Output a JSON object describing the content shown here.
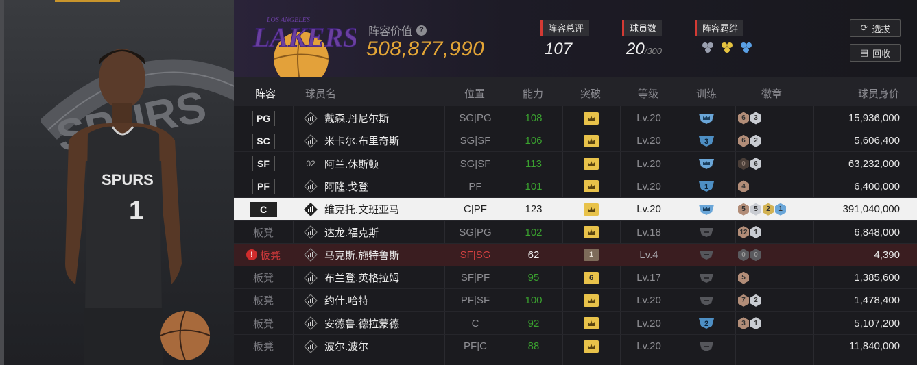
{
  "header": {
    "value_label": "阵容价值",
    "value": "508,877,990",
    "stats": [
      {
        "label": "阵容总评",
        "value": "107",
        "sub": ""
      },
      {
        "label": "球员数",
        "value": "20",
        "sub": "/300"
      },
      {
        "label": "阵容羁绊",
        "value": "",
        "sub": ""
      }
    ],
    "buttons": {
      "draft": "选拔",
      "recycle": "回收"
    },
    "team": "LOS ANGELES LAKERS",
    "accent": "#e3a536"
  },
  "table": {
    "columns": [
      "阵容",
      "球员名",
      "位置",
      "能力",
      "突破",
      "等级",
      "训练",
      "徽章",
      "球员身价"
    ],
    "rows": [
      {
        "slot": "PG",
        "signal": "bars",
        "name": "戴森.丹尼尔斯",
        "position": "SG|PG",
        "ability": "108",
        "break": "crown",
        "level": "Lv.20",
        "train": "shield-blue",
        "train_num": "",
        "medals": [
          {
            "t": "m-bronze",
            "n": "6"
          },
          {
            "t": "m-silver",
            "n": "3"
          }
        ],
        "price": "15,936,000"
      },
      {
        "slot": "SC",
        "signal": "bars",
        "name": "米卡尔.布里奇斯",
        "position": "SG|SF",
        "ability": "106",
        "break": "crown",
        "level": "Lv.20",
        "train": "num-blue",
        "train_num": "3",
        "medals": [
          {
            "t": "m-bronze",
            "n": "6"
          },
          {
            "t": "m-silver",
            "n": "2"
          }
        ],
        "price": "5,606,400"
      },
      {
        "slot": "SF",
        "signal": "text",
        "signal_text": "02",
        "name": "阿兰.休斯顿",
        "position": "SG|SF",
        "ability": "113",
        "break": "crown",
        "level": "Lv.20",
        "train": "shield-blue",
        "train_num": "",
        "medals": [
          {
            "t": "m-dark",
            "n": "0"
          },
          {
            "t": "m-silver",
            "n": "6"
          }
        ],
        "price": "63,232,000"
      },
      {
        "slot": "PF",
        "signal": "bars",
        "name": "阿隆.戈登",
        "position": "PF",
        "ability": "101",
        "break": "crown",
        "level": "Lv.20",
        "train": "num-blue",
        "train_num": "1",
        "medals": [
          {
            "t": "m-bronze",
            "n": "4"
          }
        ],
        "price": "6,400,000"
      },
      {
        "slot": "C",
        "signal": "diamond",
        "name": "维克托.文班亚马",
        "position": "C|PF",
        "ability": "123",
        "break": "crown",
        "level": "Lv.20",
        "train": "shield-blue",
        "train_num": "",
        "medals": [
          {
            "t": "m-bronze",
            "n": "5"
          },
          {
            "t": "m-silver",
            "n": "5"
          },
          {
            "t": "m-gold",
            "n": "2"
          },
          {
            "t": "m-blue",
            "n": "1"
          }
        ],
        "price": "391,040,000",
        "highlight": true
      },
      {
        "slot": "板凳",
        "signal": "bars",
        "name": "达龙.福克斯",
        "position": "SG|PG",
        "ability": "102",
        "break": "crown",
        "level": "Lv.18",
        "train": "gray",
        "train_num": "",
        "medals": [
          {
            "t": "m-bronze",
            "n": "12"
          },
          {
            "t": "m-silver",
            "n": "1"
          }
        ],
        "price": "6,848,000"
      },
      {
        "slot": "板凳",
        "signal": "bars",
        "name": "马克斯.施特鲁斯",
        "position": "SF|SG",
        "ability": "62",
        "break": "num-brown",
        "break_num": "1",
        "level": "Lv.4",
        "train": "gray",
        "train_num": "",
        "medals": [
          {
            "t": "m-gray",
            "n": "0"
          },
          {
            "t": "m-gray",
            "n": "0"
          }
        ],
        "price": "4,390",
        "warn": true
      },
      {
        "slot": "板凳",
        "signal": "bars",
        "name": "布兰登.英格拉姆",
        "position": "SF|PF",
        "ability": "95",
        "break": "num-gold",
        "break_num": "6",
        "level": "Lv.17",
        "train": "gray",
        "train_num": "",
        "medals": [
          {
            "t": "m-bronze",
            "n": "5"
          }
        ],
        "price": "1,385,600"
      },
      {
        "slot": "板凳",
        "signal": "bars",
        "name": "约什.哈特",
        "position": "PF|SF",
        "ability": "100",
        "break": "crown",
        "level": "Lv.20",
        "train": "gray",
        "train_num": "",
        "medals": [
          {
            "t": "m-bronze",
            "n": "7"
          },
          {
            "t": "m-silver",
            "n": "2"
          }
        ],
        "price": "1,478,400"
      },
      {
        "slot": "板凳",
        "signal": "bars",
        "name": "安德鲁.德拉蒙德",
        "position": "C",
        "ability": "92",
        "break": "crown",
        "level": "Lv.20",
        "train": "num-blue",
        "train_num": "2",
        "medals": [
          {
            "t": "m-bronze",
            "n": "3"
          },
          {
            "t": "m-silver",
            "n": "1"
          }
        ],
        "price": "5,107,200"
      },
      {
        "slot": "板凳",
        "signal": "bars",
        "name": "波尔.波尔",
        "position": "PF|C",
        "ability": "88",
        "break": "crown",
        "level": "Lv.20",
        "train": "gray",
        "train_num": "",
        "medals": [],
        "price": "11,840,000"
      }
    ]
  }
}
